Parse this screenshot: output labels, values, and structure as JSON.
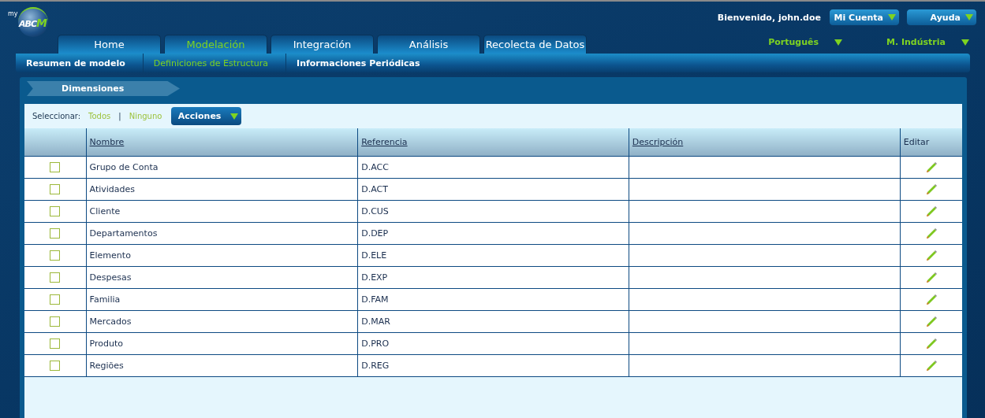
{
  "logo": {
    "prefix": "my",
    "text": "ABC",
    "accent": "M"
  },
  "user": {
    "greeting": "Bienvenido, john.doe",
    "buttons": [
      "Mi Cuenta",
      "Ayuda"
    ]
  },
  "tabs": [
    {
      "label": "Home",
      "selected": false
    },
    {
      "label": "Modelación",
      "selected": true
    },
    {
      "label": "Integración",
      "selected": false
    },
    {
      "label": "Análisis",
      "selected": false
    },
    {
      "label": "Recolecta de Datos",
      "selected": false
    }
  ],
  "selectors": [
    "Português",
    "M. Indústria"
  ],
  "subtabs": [
    {
      "label": "Resumen de modelo",
      "selected": false
    },
    {
      "label": "Definiciones de Estructura",
      "selected": true
    },
    {
      "label": "Informaciones Periódicas",
      "selected": false
    }
  ],
  "breadcrumb": "Dimensiones",
  "toolbar": {
    "label": "Seleccionar:",
    "all": "Todos",
    "separator": "|",
    "none": "Ninguno",
    "actions": "Acciones"
  },
  "table": {
    "columns": [
      "Nombre",
      "Referencia",
      "Descripción",
      "Editar"
    ],
    "rows": [
      {
        "name": "Grupo de Conta",
        "reference": "D.ACC",
        "checked": false
      },
      {
        "name": "Atividades",
        "reference": "D.ACT",
        "checked": false
      },
      {
        "name": "Cliente",
        "reference": "D.CUS",
        "checked": false
      },
      {
        "name": "Departamentos",
        "reference": "D.DEP",
        "checked": false
      },
      {
        "name": "Elemento",
        "reference": "D.ELE",
        "checked": false
      },
      {
        "name": "Despesas",
        "reference": "D.EXP",
        "checked": false
      },
      {
        "name": "Familia",
        "reference": "D.FAM",
        "checked": false
      },
      {
        "name": "Mercados",
        "reference": "D.MAR",
        "checked": false
      },
      {
        "name": "Produto",
        "reference": "D.PRO",
        "checked": false
      },
      {
        "name": "Regiões",
        "reference": "D.REG",
        "checked": false
      }
    ]
  }
}
